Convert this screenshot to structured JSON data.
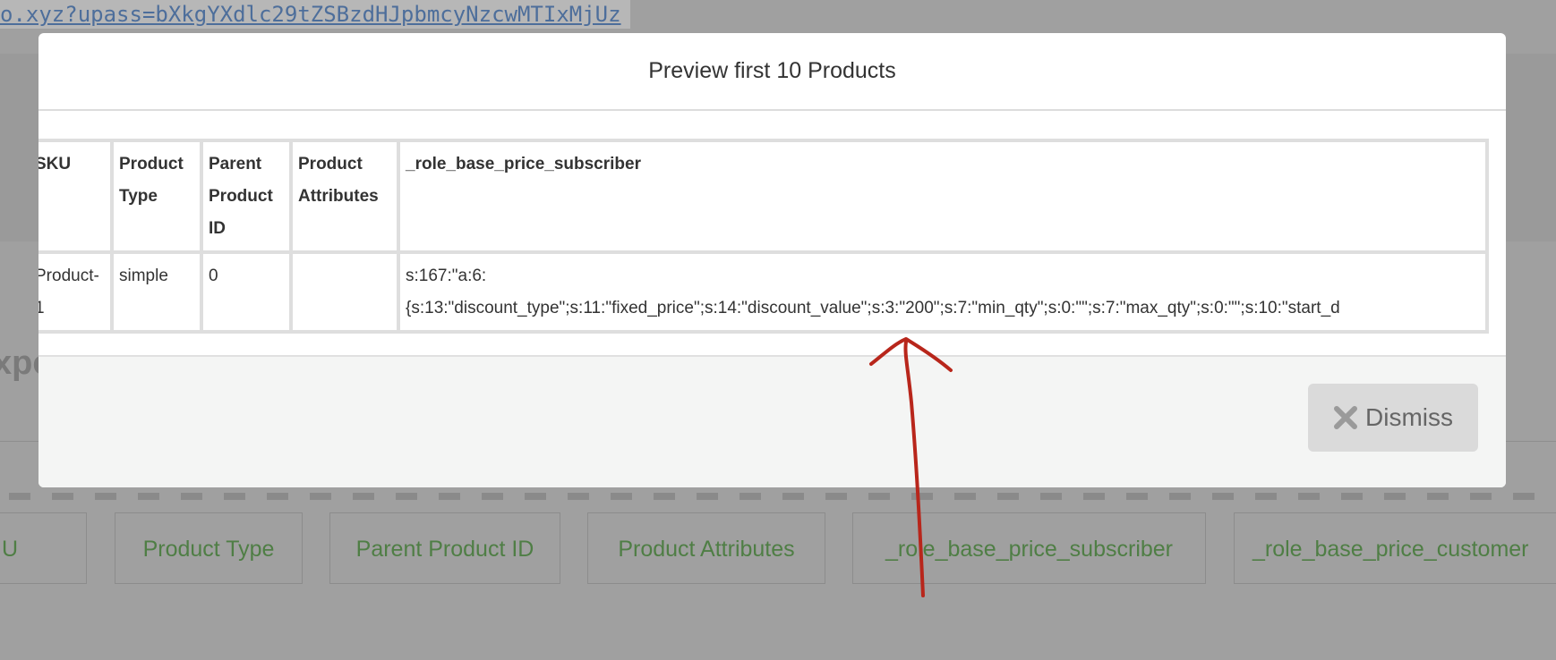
{
  "background": {
    "url_text": "o.xyz?upass=bXkgYXdlc29tZSBzdHJpbmcyNzcwMTIxMjUz",
    "heading_fragment": "xpo",
    "chips": [
      {
        "label": "U"
      },
      {
        "label": "Product Type"
      },
      {
        "label": "Parent Product ID"
      },
      {
        "label": "Product Attributes"
      },
      {
        "label": "_role_base_price_subscriber"
      },
      {
        "label": "_role_base_price_customer"
      }
    ]
  },
  "modal": {
    "title": "Preview first 10 Products",
    "table": {
      "headers": {
        "sku": "SKU",
        "product_type": "Product Type",
        "parent_product_id": "Parent Product ID",
        "product_attributes": "Product Attributes",
        "role_base_price_subscriber": "_role_base_price_subscriber"
      },
      "rows": [
        {
          "sku": "Product-1",
          "product_type": "simple",
          "parent_product_id": "0",
          "product_attributes": "",
          "role_base_price_subscriber_line1": "s:167:\"a:6:",
          "role_base_price_subscriber_line2": "{s:13:\"discount_type\";s:11:\"fixed_price\";s:14:\"discount_value\";s:3:\"200\";s:7:\"min_qty\";s:0:\"\";s:7:\"max_qty\";s:0:\"\";s:10:\"start_d"
        }
      ]
    },
    "dismiss_label": "Dismiss"
  },
  "colors": {
    "overlay": "#a0a0a0",
    "chip_text": "#4f7e45",
    "annotation_arrow": "#b8261b",
    "dismiss_bg": "#dadada"
  }
}
